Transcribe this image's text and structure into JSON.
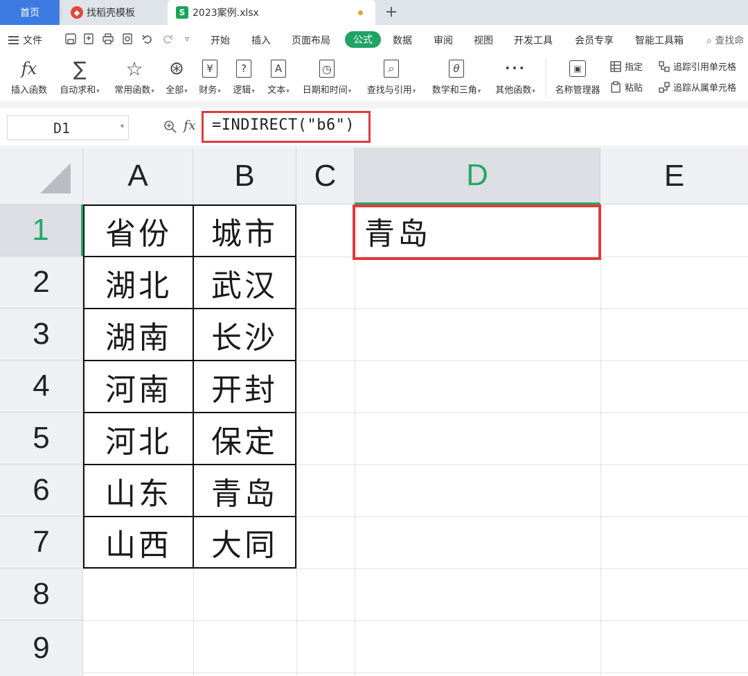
{
  "tabs": {
    "home": "首页",
    "template": "找稻壳模板",
    "active_file": "2023案例.xlsx",
    "add_symbol": "+"
  },
  "menu": {
    "file": "文件",
    "items": [
      "开始",
      "插入",
      "页面布局",
      "公式",
      "数据",
      "审阅",
      "视图",
      "开发工具",
      "会员专享",
      "智能工具箱"
    ],
    "active": "公式",
    "search": "查找命"
  },
  "ribbon": {
    "buttons": [
      {
        "label": "插入函数",
        "icon": "fx-icon",
        "glyph": "fx",
        "dropdown": false
      },
      {
        "label": "自动求和",
        "icon": "sum-icon",
        "glyph": "∑",
        "dropdown": true
      },
      {
        "label": "常用函数",
        "icon": "star-icon",
        "glyph": "☆",
        "dropdown": true
      },
      {
        "label": "全部",
        "icon": "all-functions-icon",
        "glyph": "⊛",
        "dropdown": true
      },
      {
        "label": "财务",
        "icon": "finance-icon",
        "glyph": "¥",
        "dropdown": true
      },
      {
        "label": "逻辑",
        "icon": "logic-icon",
        "glyph": "?",
        "dropdown": true
      },
      {
        "label": "文本",
        "icon": "text-icon",
        "glyph": "A",
        "dropdown": true
      },
      {
        "label": "日期和时间",
        "icon": "clock-icon",
        "glyph": "◷",
        "dropdown": true
      },
      {
        "label": "查找与引用",
        "icon": "lookup-icon",
        "glyph": "⌕",
        "dropdown": true
      },
      {
        "label": "数学和三角",
        "icon": "math-icon",
        "glyph": "θ",
        "dropdown": true
      },
      {
        "label": "其他函数",
        "icon": "more-functions-icon",
        "glyph": "•••",
        "dropdown": true
      },
      {
        "label": "名称管理器",
        "icon": "name-manager-icon",
        "glyph": "▣",
        "dropdown": false
      }
    ],
    "small": {
      "specify": "指定",
      "paste": "粘贴",
      "trace_precedents": "追踪引用单元格",
      "trace_dependents": "追踪从属单元格"
    }
  },
  "formula_bar": {
    "name_box": "D1",
    "fx": "fx",
    "formula": "=INDIRECT(\"b6\")"
  },
  "sheet": {
    "columns": [
      "A",
      "B",
      "C",
      "D",
      "E"
    ],
    "selected_column": "D",
    "rows": [
      "1",
      "2",
      "3",
      "4",
      "5",
      "6",
      "7",
      "8",
      "9"
    ],
    "selected_row": "1",
    "table": [
      [
        "省份",
        "城市"
      ],
      [
        "湖北",
        "武汉"
      ],
      [
        "湖南",
        "长沙"
      ],
      [
        "河南",
        "开封"
      ],
      [
        "河北",
        "保定"
      ],
      [
        "山东",
        "青岛"
      ],
      [
        "山西",
        "大同"
      ]
    ],
    "d1_value": "青岛",
    "highlight_color": "#e03a3e",
    "selection_color": "#23a866"
  }
}
